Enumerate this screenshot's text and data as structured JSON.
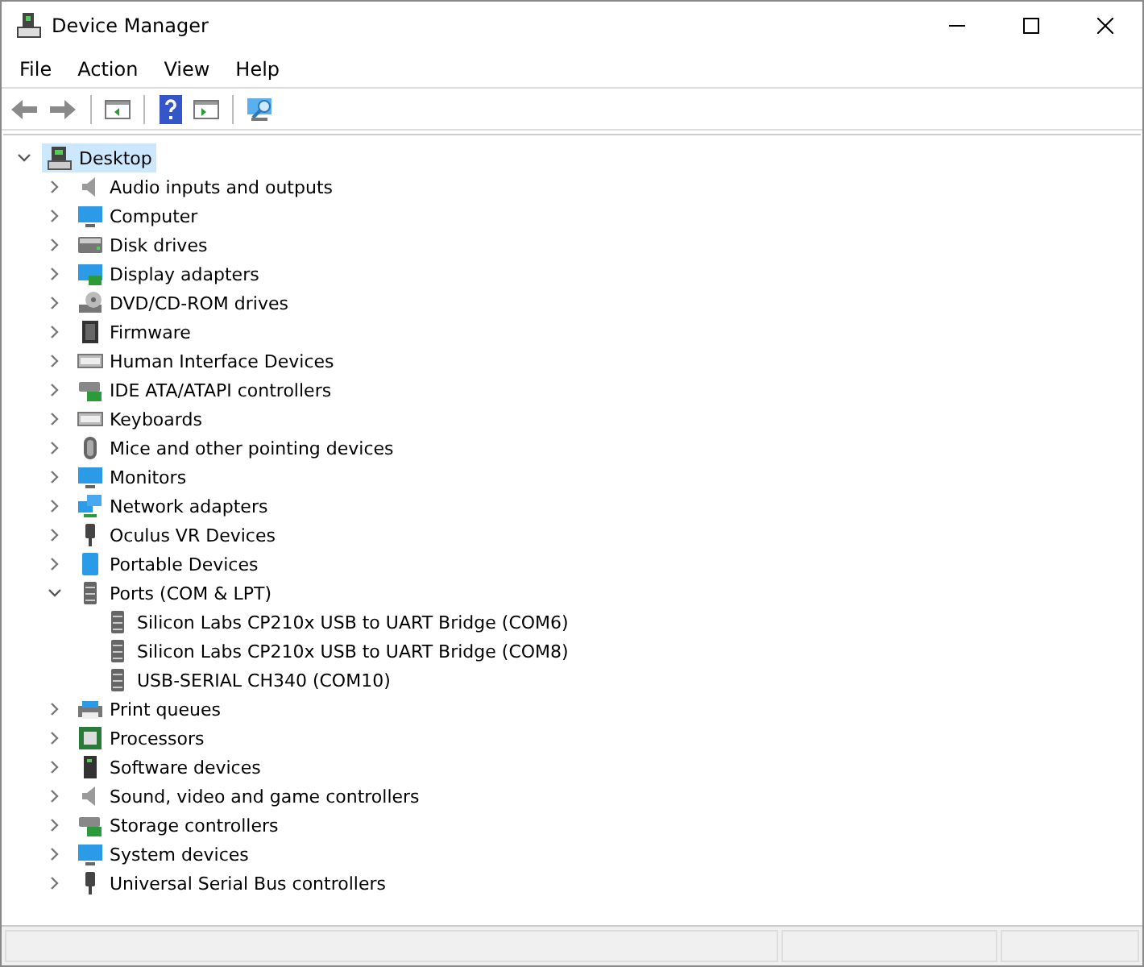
{
  "window": {
    "title": "Device Manager"
  },
  "menu": [
    "File",
    "Action",
    "View",
    "Help"
  ],
  "tree": [
    {
      "label": "Desktop",
      "expanded": true,
      "selected": true,
      "children": [
        {
          "label": "Audio inputs and outputs",
          "expanded": false,
          "selected": false
        },
        {
          "label": "Computer",
          "expanded": false,
          "selected": false
        },
        {
          "label": "Disk drives",
          "expanded": false,
          "selected": false
        },
        {
          "label": "Display adapters",
          "expanded": false,
          "selected": false
        },
        {
          "label": "DVD/CD-ROM drives",
          "expanded": false,
          "selected": false
        },
        {
          "label": "Firmware",
          "expanded": false,
          "selected": false
        },
        {
          "label": "Human Interface Devices",
          "expanded": false,
          "selected": false
        },
        {
          "label": "IDE ATA/ATAPI controllers",
          "expanded": false,
          "selected": false
        },
        {
          "label": "Keyboards",
          "expanded": false,
          "selected": false
        },
        {
          "label": "Mice and other pointing devices",
          "expanded": false,
          "selected": false
        },
        {
          "label": "Monitors",
          "expanded": false,
          "selected": false
        },
        {
          "label": "Network adapters",
          "expanded": false,
          "selected": false
        },
        {
          "label": "Oculus VR Devices",
          "expanded": false,
          "selected": false
        },
        {
          "label": "Portable Devices",
          "expanded": false,
          "selected": false
        },
        {
          "label": "Ports (COM & LPT)",
          "expanded": true,
          "selected": false,
          "children": [
            {
              "label": "Silicon Labs CP210x USB to UART Bridge (COM6)",
              "selected": false
            },
            {
              "label": "Silicon Labs CP210x USB to UART Bridge (COM8)",
              "selected": false
            },
            {
              "label": "USB-SERIAL CH340 (COM10)",
              "selected": false
            }
          ]
        },
        {
          "label": "Print queues",
          "expanded": false,
          "selected": false
        },
        {
          "label": "Processors",
          "expanded": false,
          "selected": false
        },
        {
          "label": "Software devices",
          "expanded": false,
          "selected": false
        },
        {
          "label": "Sound, video and game controllers",
          "expanded": false,
          "selected": false
        },
        {
          "label": "Storage controllers",
          "expanded": false,
          "selected": false
        },
        {
          "label": "System devices",
          "expanded": false,
          "selected": false
        },
        {
          "label": "Universal Serial Bus controllers",
          "expanded": false,
          "selected": false
        }
      ]
    }
  ]
}
